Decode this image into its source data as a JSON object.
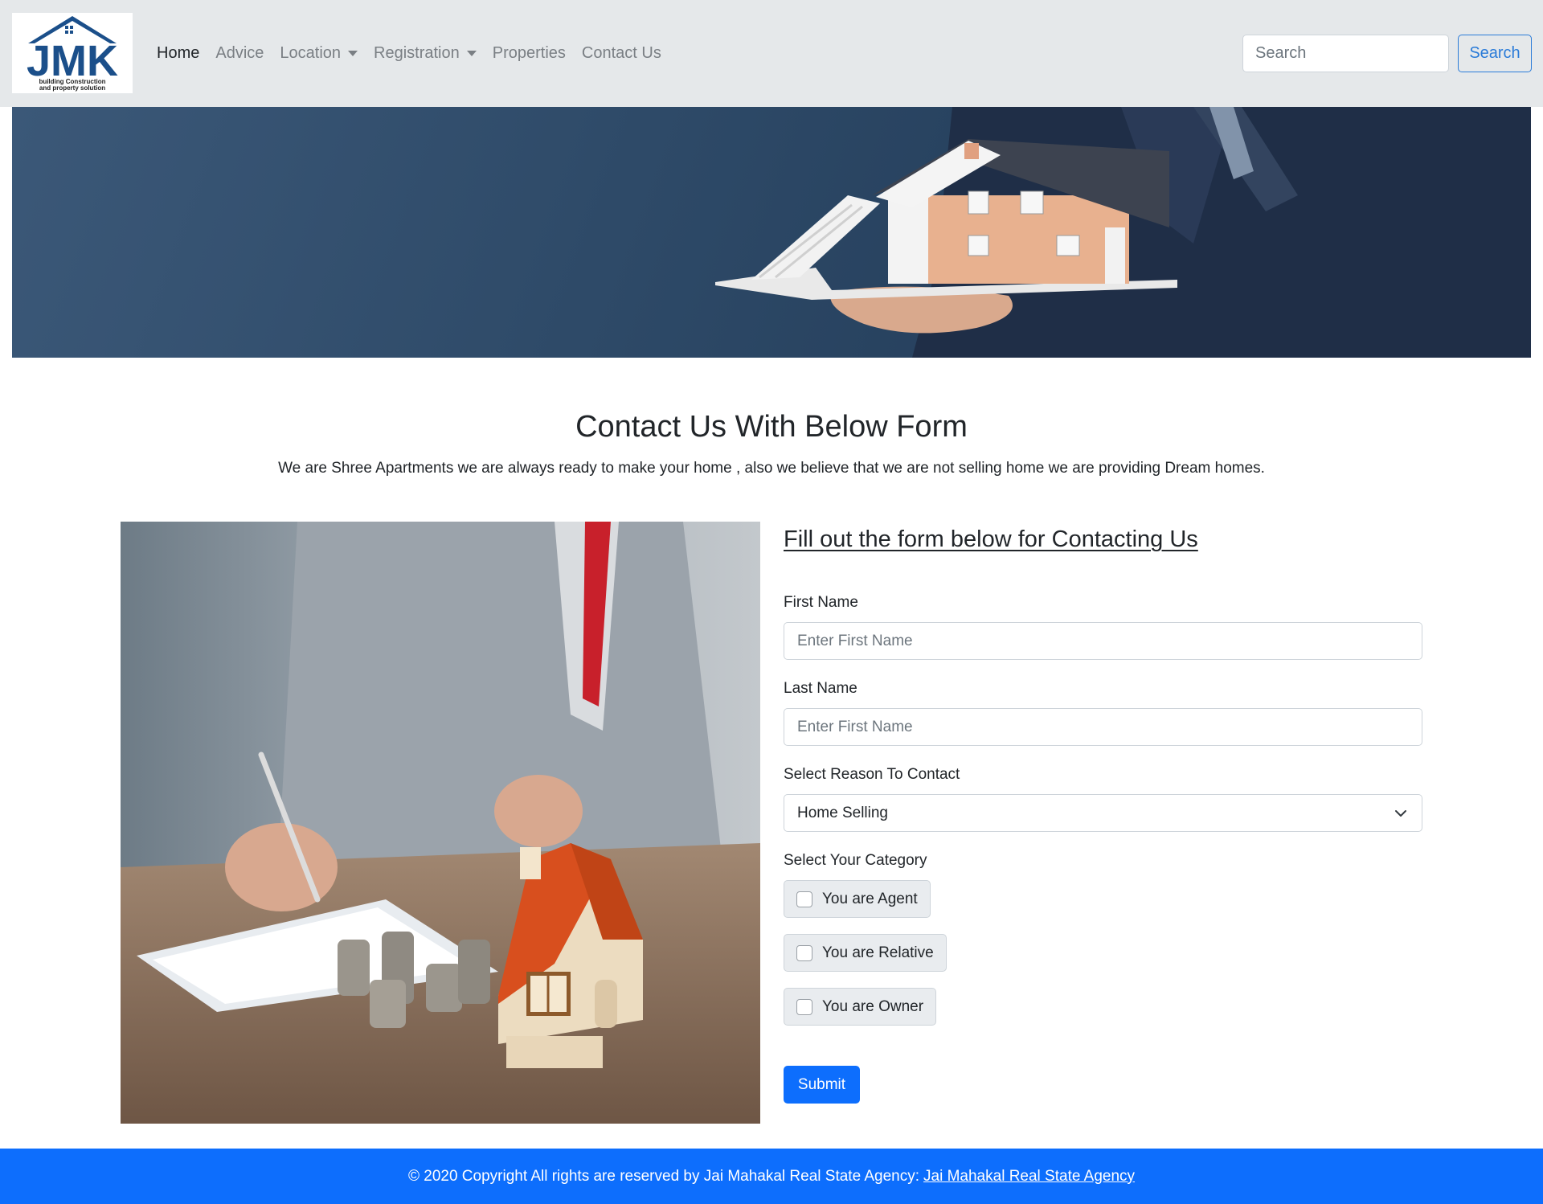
{
  "navbar": {
    "logo_text": "JMK",
    "logo_tagline_1": "building Construction",
    "logo_tagline_2": "and property solution",
    "links": [
      {
        "label": "Home",
        "active": true
      },
      {
        "label": "Advice"
      },
      {
        "label": "Location",
        "dropdown": true
      },
      {
        "label": "Registration",
        "dropdown": true
      },
      {
        "label": "Properties"
      },
      {
        "label": "Contact Us"
      }
    ],
    "search_placeholder": "Search",
    "search_button": "Search"
  },
  "main": {
    "heading": "Contact Us With Below Form",
    "subheading": "We are Shree Apartments we are always ready to make your home , also we believe that we are not selling home we are providing Dream homes."
  },
  "form": {
    "title": "Fill out the form below for Contacting Us",
    "first_name_label": "First Name",
    "first_name_placeholder": "Enter First Name",
    "last_name_label": "Last Name",
    "last_name_placeholder": "Enter First Name",
    "reason_label": "Select Reason To Contact",
    "reason_value": "Home Selling",
    "category_label": "Select Your Category",
    "categories": [
      "You are Agent",
      "You are Relative",
      "You are Owner"
    ],
    "submit": "Submit"
  },
  "footer": {
    "text": "© 2020 Copyright All rights are reserved by Jai Mahakal Real State Agency:",
    "link": "Jai Mahakal Real State Agency"
  },
  "colors": {
    "primary": "#0d6efd",
    "navbar_bg": "#e5e8ea",
    "banner_bg": "#2e4a68",
    "logo_blue": "#1b4f8a"
  }
}
